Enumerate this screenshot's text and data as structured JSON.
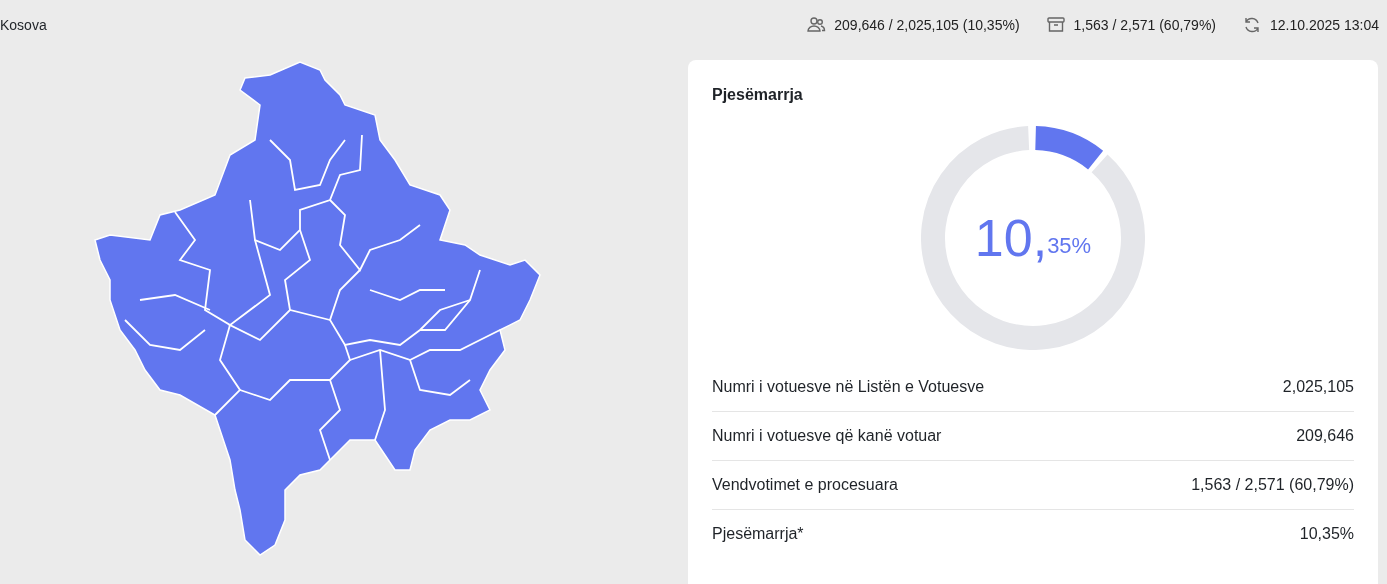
{
  "header": {
    "region": "Kosova",
    "stats": [
      {
        "kind": "people",
        "text": "209,646 / 2,025,105 (10,35%)"
      },
      {
        "kind": "box",
        "text": "1,563 / 2,571 (60,79%)"
      },
      {
        "kind": "refresh",
        "text": "12.10.2025 13:04"
      }
    ]
  },
  "card": {
    "title": "Pjesëmarrja",
    "gauge": {
      "big": "10,",
      "small": "35%"
    },
    "rows": [
      {
        "label": "Numri i votuesve në Listën e Votuesve",
        "value": "2,025,105"
      },
      {
        "label": "Numri i votuesve që kanë votuar",
        "value": "209,646"
      },
      {
        "label": "Vendvotimet e procesuara",
        "value": "1,563 / 2,571 (60,79%)"
      },
      {
        "label": "Pjesëmarrja*",
        "value": "10,35%"
      }
    ]
  }
}
